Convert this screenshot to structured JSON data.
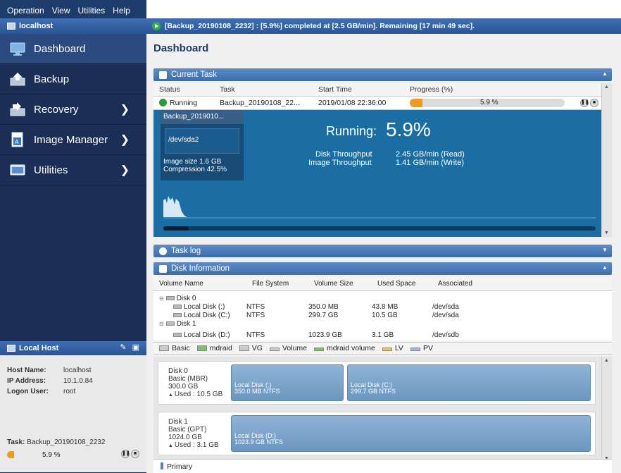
{
  "menu": [
    "Operation",
    "View",
    "Utilities",
    "Help"
  ],
  "host_header": "localhost",
  "status_message": "[Backup_20190108_2232] : [5.9%] completed at [2.5 GB/min]. Remaining [17 min 49 sec].",
  "nav": [
    {
      "label": "Dashboard",
      "icon": "monitor-icon",
      "chevron": ""
    },
    {
      "label": "Backup",
      "icon": "backup-icon",
      "chevron": ""
    },
    {
      "label": "Recovery",
      "icon": "recovery-icon",
      "chevron": "❯"
    },
    {
      "label": "Image Manager",
      "icon": "image-manager-icon",
      "chevron": "❯"
    },
    {
      "label": "Utilities",
      "icon": "utilities-icon",
      "chevron": "❯"
    }
  ],
  "local_host": {
    "header": "Local Host",
    "host_name_label": "Host Name:",
    "host_name": "localhost",
    "ip_label": "IP Address:",
    "ip": "10.1.0.84",
    "logon_label": "Logon User:",
    "logon": "root",
    "task_label": "Task:",
    "task": "Backup_20190108_2232",
    "progress_text": "5.9 %",
    "progress": 0.059,
    "collapse": "«"
  },
  "page_title": "Dashboard",
  "current_task": {
    "title": "Current Task",
    "headers": [
      "Status",
      "Task",
      "Start Time",
      "Progress (%)"
    ],
    "row": {
      "status": "Running",
      "task": "Backup_20190108_22...",
      "start": "2019/01/08 22:36:00",
      "progress_text": "5.9 %",
      "progress": 0.059
    },
    "graph": {
      "box_title": "Backup_2019010...",
      "device": "/dev/sda2",
      "image_size": "Image size  1.6 GB",
      "compression": "Compression  42.5%",
      "running_label": "Running:",
      "running_pct": "5.9%",
      "disk_tp_label": "Disk Throughput",
      "disk_tp": "2.45 GB/min (Read)",
      "image_tp_label": "Image Throughput",
      "image_tp": "1.41 GB/min (Write)"
    }
  },
  "task_log": {
    "title": "Task log"
  },
  "disk_info": {
    "title": "Disk Information",
    "headers": [
      "Volume Name",
      "File System",
      "Volume Size",
      "Used Space",
      "Associated"
    ],
    "rows": [
      {
        "name": "Disk 0",
        "fs": "",
        "size": "",
        "used": "",
        "assoc": "",
        "level": 0
      },
      {
        "name": "Local Disk (:)",
        "fs": "NTFS",
        "size": "350.0 MB",
        "used": "43.8 MB",
        "assoc": "/dev/sda",
        "level": 1
      },
      {
        "name": "Local Disk (C:)",
        "fs": "NTFS",
        "size": "299.7 GB",
        "used": "10.5 GB",
        "assoc": "/dev/sda",
        "level": 1
      },
      {
        "name": "Disk 1",
        "fs": "",
        "size": "",
        "used": "",
        "assoc": "",
        "level": 0
      },
      {
        "name": "Local Disk (D:)",
        "fs": "NTFS",
        "size": "1023.9 GB",
        "used": "3.1 GB",
        "assoc": "/dev/sdb",
        "level": 1
      }
    ],
    "legend": [
      "Basic",
      "mdraid",
      "VG",
      "Volume",
      "mdraid volume",
      "LV",
      "PV"
    ]
  },
  "disk_maps": [
    {
      "name": "Disk 0",
      "type": "Basic (MBR)",
      "size": "300.0 GB",
      "used": "Used : 10.5 GB",
      "parts": [
        {
          "label": "Local Disk (:)",
          "detail": "350.0 MB NTFS"
        },
        {
          "label": "Local Disk (C:)",
          "detail": "299.7 GB NTFS"
        }
      ]
    },
    {
      "name": "Disk 1",
      "type": "Basic (GPT)",
      "size": "1024.0 GB",
      "used": "Used : 3.1 GB",
      "parts": [
        {
          "label": "Local Disk (D:)",
          "detail": "1023.9 GB NTFS"
        }
      ]
    }
  ],
  "primary_label": "Primary"
}
